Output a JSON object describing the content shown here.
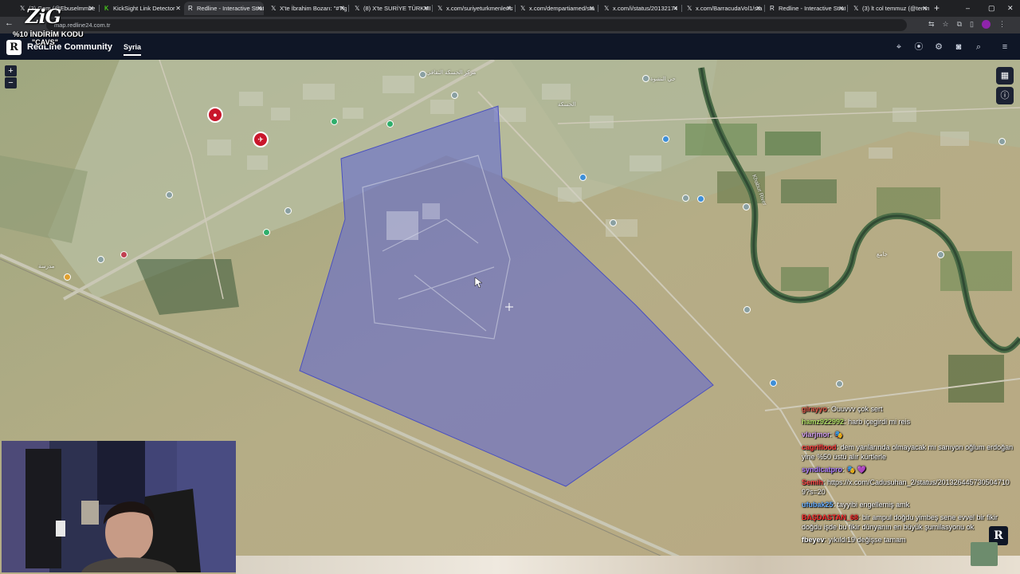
{
  "browser": {
    "tabs": [
      {
        "title": "(3) Gem (@Ebuselmmbebar)",
        "active": false
      },
      {
        "title": "KickSight Link Detector",
        "active": false
      },
      {
        "title": "Redline - Interactive Strat",
        "active": true
      },
      {
        "title": "X'te İbrahim Bozarı: \"#Tig",
        "active": false
      },
      {
        "title": "(8) X'te SURİYE TÜRKMEN",
        "active": false
      },
      {
        "title": "x.com/suriyeturkmenler/sta",
        "active": false
      },
      {
        "title": "x.com/dempartiamed/sta",
        "active": false
      },
      {
        "title": "x.com/i/status/20132174",
        "active": false
      },
      {
        "title": "x.com/BarracudaVol1/sta",
        "active": false
      },
      {
        "title": "Redline - Interactive Strat",
        "active": false
      },
      {
        "title": "(3) lt col temmuz (@temm",
        "active": false
      }
    ],
    "url": "map.redline24.com.tr",
    "window_controls": [
      "–",
      "▢",
      "✕"
    ]
  },
  "overlay_logo": {
    "mark": "ZiG",
    "line1": "%10 İNDİRİM KODU",
    "line2": "\"CAVS\""
  },
  "app": {
    "name": "RedLine Community",
    "logo_letter": "R",
    "region_tab": "Syria",
    "header_icons": [
      "tag-icon",
      "pin-icon",
      "settings-icon",
      "camera-icon",
      "search-icon",
      "menu-icon"
    ]
  },
  "map": {
    "zoom_in": "+",
    "zoom_out": "−",
    "side_buttons": [
      "map-layers-icon",
      "info-icon"
    ],
    "shaded_area_color": "#5b62d6",
    "labels": [
      "مركز الحسكة الثقافي",
      "الحسكة",
      "حي النشوة",
      "مدرسة",
      "جامع",
      "Khabur River"
    ]
  },
  "chat": {
    "messages": [
      {
        "user": "girayyo",
        "user_color": "#e05a4a",
        "text": "Ouuvvv çok sert"
      },
      {
        "user": "hamz922992",
        "user_color": "#b5e36a",
        "text": "harb içegirdi mi reis"
      },
      {
        "user": "vlarjmor",
        "user_color": "#d4a0f0",
        "text": "🎭"
      },
      {
        "user": "cagriflood",
        "user_color": "#ff4040",
        "text": "dem yanlarında olmayacak mı sanıyon oğlum erdoğan yine %50 üstü alır kürtlerle"
      },
      {
        "user": "syndicatpro",
        "user_color": "#b080ff",
        "text": "🎭 💜"
      },
      {
        "user": "Semih",
        "user_color": "#ff4a4a",
        "text": "https://x.com/Cadusuhan_2/status/2013264457305047109?s=20"
      },
      {
        "user": "ufubak25",
        "user_color": "#6ab0ff",
        "text": "tayyibi engellemiş amk"
      },
      {
        "user": "BAŞDASTAN_68",
        "user_color": "#ff3030",
        "text": "bir ampul doğdu yimbeş sene evvel bir fikir doğdu işde bu fikir dünyanın en büyük şumilasyonu ok"
      },
      {
        "user": "fbeyev",
        "user_color": "#ffffff",
        "text": "yıkıldı19 değişse tamam"
      }
    ]
  }
}
